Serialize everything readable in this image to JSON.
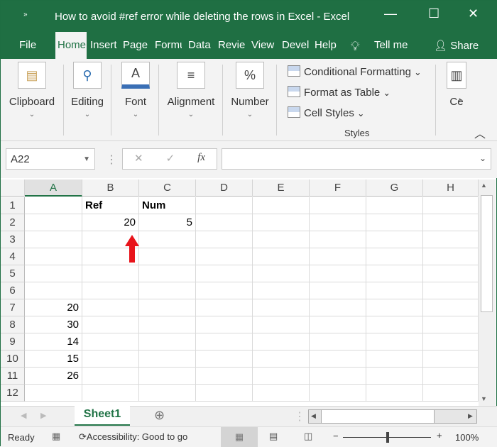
{
  "window": {
    "title": "How to avoid #ref error while deleting the rows in Excel  -  Excel",
    "qat": "»",
    "minimize": "—",
    "maximize": "☐",
    "close": "✕"
  },
  "tabs": [
    "File",
    "Home",
    "Insert",
    "Page",
    "Formu",
    "Data",
    "Revie",
    "View",
    "Devel",
    "Help"
  ],
  "tell_me": "Tell me",
  "share": "Share",
  "ribbon": {
    "groups": [
      {
        "label": "Clipboard",
        "icon": "clipboard-icon",
        "glyph": "📋"
      },
      {
        "label": "Editing",
        "icon": "search-icon",
        "glyph": "⚲"
      },
      {
        "label": "Font",
        "icon": "font-icon",
        "glyph": "A"
      },
      {
        "label": "Alignment",
        "icon": "align-icon",
        "glyph": "≡"
      },
      {
        "label": "Number",
        "icon": "percent-icon",
        "glyph": "%"
      }
    ],
    "styles": {
      "items": [
        "Conditional Formatting",
        "Format as Table",
        "Cell Styles"
      ],
      "label": "Styles"
    },
    "cells_label": "Ce"
  },
  "formula_bar": {
    "name_box": "A22",
    "cancel": "✕",
    "enter": "✓",
    "fx": "fx",
    "value": ""
  },
  "grid": {
    "columns": [
      "A",
      "B",
      "C",
      "D",
      "E",
      "F",
      "G",
      "H"
    ],
    "rows": [
      "1",
      "2",
      "3",
      "4",
      "5",
      "6",
      "7",
      "8",
      "9",
      "10",
      "11",
      "12"
    ],
    "cells": [
      {
        "r": 0,
        "c": 1,
        "v": "Ref",
        "bold": true
      },
      {
        "r": 0,
        "c": 2,
        "v": "Num",
        "bold": true
      },
      {
        "r": 1,
        "c": 1,
        "v": "20",
        "num": true
      },
      {
        "r": 1,
        "c": 2,
        "v": "5",
        "num": true
      },
      {
        "r": 6,
        "c": 0,
        "v": "20",
        "num": true
      },
      {
        "r": 7,
        "c": 0,
        "v": "30",
        "num": true
      },
      {
        "r": 8,
        "c": 0,
        "v": "14",
        "num": true
      },
      {
        "r": 9,
        "c": 0,
        "v": "15",
        "num": true
      },
      {
        "r": 10,
        "c": 0,
        "v": "26",
        "num": true
      }
    ],
    "selected_column": "A",
    "arrow_color": "#e8141b"
  },
  "sheets": [
    "Sheet1"
  ],
  "status": {
    "ready": "Ready",
    "accessibility": "Accessibility: Good to go",
    "zoom": "100%",
    "zoom_percent": 100
  }
}
